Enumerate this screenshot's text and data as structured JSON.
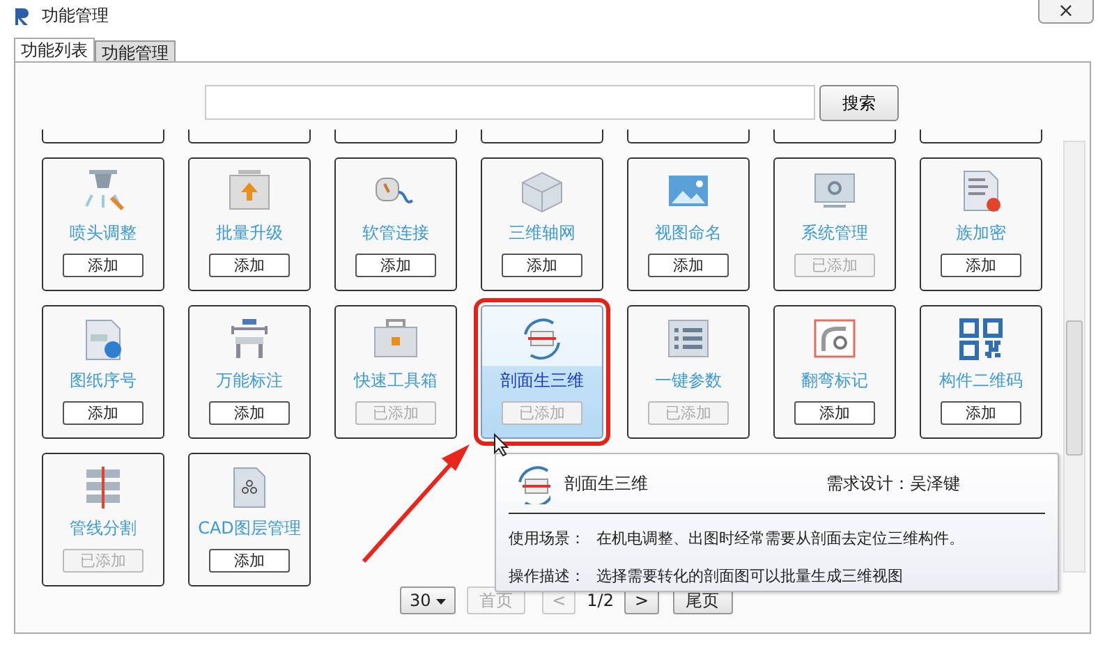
{
  "window": {
    "title": "功能管理",
    "close": "×"
  },
  "tabs": [
    {
      "label": "功能列表",
      "selected": true
    },
    {
      "label": "功能管理",
      "selected": false
    }
  ],
  "search": {
    "button": "搜索"
  },
  "cards": [
    {
      "name": "喷头调整",
      "button": "添加",
      "added": false,
      "selected": false
    },
    {
      "name": "批量升级",
      "button": "添加",
      "added": false,
      "selected": false
    },
    {
      "name": "软管连接",
      "button": "添加",
      "added": false,
      "selected": false
    },
    {
      "name": "三维轴网",
      "button": "添加",
      "added": false,
      "selected": false
    },
    {
      "name": "视图命名",
      "button": "添加",
      "added": false,
      "selected": false
    },
    {
      "name": "系统管理",
      "button": "已添加",
      "added": true,
      "selected": false
    },
    {
      "name": "族加密",
      "button": "添加",
      "added": false,
      "selected": false
    },
    {
      "name": "图纸序号",
      "button": "添加",
      "added": false,
      "selected": false
    },
    {
      "name": "万能标注",
      "button": "添加",
      "added": false,
      "selected": false
    },
    {
      "name": "快速工具箱",
      "button": "已添加",
      "added": true,
      "selected": false
    },
    {
      "name": "剖面生三维",
      "button": "已添加",
      "added": true,
      "selected": true
    },
    {
      "name": "一键参数",
      "button": "已添加",
      "added": true,
      "selected": false
    },
    {
      "name": "翻弯标记",
      "button": "添加",
      "added": false,
      "selected": false
    },
    {
      "name": "构件二维码",
      "button": "添加",
      "added": false,
      "selected": false
    },
    {
      "name": "管线分割",
      "button": "已添加",
      "added": true,
      "selected": false
    },
    {
      "name": "CAD图层管理",
      "button": "添加",
      "added": false,
      "selected": false
    }
  ],
  "tooltip": {
    "title": "剖面生三维",
    "designer": "需求设计：吴泽键",
    "rows": [
      {
        "label": "使用场景：",
        "text": "在机电调整、出图时经常需要从剖面去定位三维构件。"
      },
      {
        "label": "操作描述：",
        "text": "选择需要转化的剖面图可以批量生成三维视图"
      }
    ]
  },
  "pagination": {
    "page_size": "30",
    "first": "首页",
    "first_disabled": true,
    "prev": "<",
    "prev_disabled": true,
    "page": "1/2",
    "next": ">",
    "last": "尾页"
  }
}
